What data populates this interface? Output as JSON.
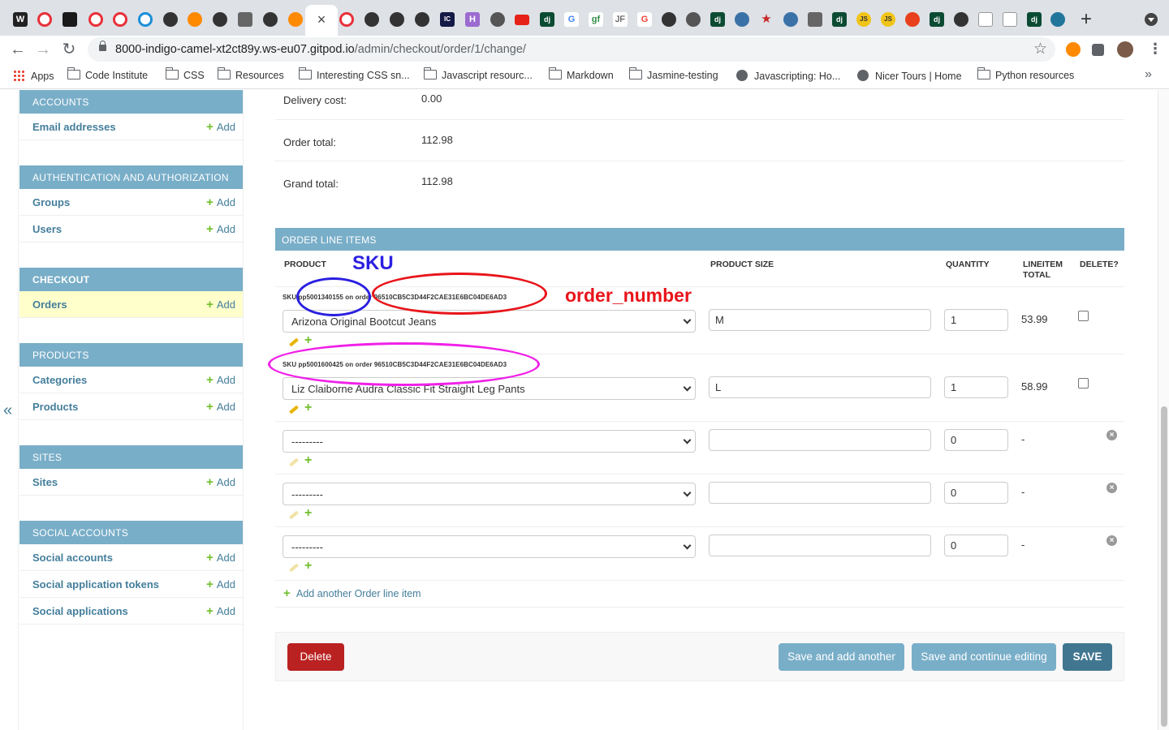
{
  "browser": {
    "url_host": "8000-indigo-camel-xt2ct89y.ws-eu07.gitpod.io",
    "url_path": "/admin/checkout/order/1/change/",
    "tab_icons": [
      "W",
      "O",
      "",
      "O",
      "O",
      "O",
      "",
      "G",
      "",
      "",
      "",
      "G",
      "×",
      "O",
      "",
      "",
      "",
      "IC",
      "H",
      "",
      "",
      "dj",
      "G",
      "gf",
      "JF",
      "G",
      "",
      "",
      "dj",
      "",
      "★",
      "",
      "",
      "dj",
      "JS",
      "JS",
      "",
      "dj",
      "",
      "",
      "",
      "dj",
      "",
      "+"
    ],
    "bookmarks": [
      {
        "label": "Apps",
        "icon": "apps-icon"
      },
      {
        "label": "Code Institute",
        "icon": "folder-icon"
      },
      {
        "label": "CSS",
        "icon": "folder-icon"
      },
      {
        "label": "Resources",
        "icon": "folder-icon"
      },
      {
        "label": "Interesting CSS sn...",
        "icon": "folder-icon"
      },
      {
        "label": "Javascript resourc...",
        "icon": "folder-icon"
      },
      {
        "label": "Markdown",
        "icon": "folder-icon"
      },
      {
        "label": "Jasmine-testing",
        "icon": "folder-icon"
      },
      {
        "label": "Javascripting: Ho...",
        "icon": "globe-icon"
      },
      {
        "label": "Nicer Tours | Home",
        "icon": "globe-icon"
      },
      {
        "label": "Python resources",
        "icon": "folder-icon"
      }
    ],
    "more": "»"
  },
  "sidebar": {
    "add_label": "Add",
    "modules": [
      {
        "title": "ACCOUNTS",
        "items": [
          {
            "name": "Email addresses"
          }
        ]
      },
      {
        "title": "AUTHENTICATION AND AUTHORIZATION",
        "items": [
          {
            "name": "Groups"
          },
          {
            "name": "Users"
          }
        ]
      },
      {
        "title": "CHECKOUT",
        "items": [
          {
            "name": "Orders"
          }
        ]
      },
      {
        "title": "PRODUCTS",
        "items": [
          {
            "name": "Categories"
          },
          {
            "name": "Products"
          }
        ]
      },
      {
        "title": "SITES",
        "items": [
          {
            "name": "Sites"
          }
        ]
      },
      {
        "title": "SOCIAL ACCOUNTS",
        "items": [
          {
            "name": "Social accounts"
          },
          {
            "name": "Social application tokens"
          },
          {
            "name": "Social applications"
          }
        ]
      }
    ],
    "collapse": "«"
  },
  "order": {
    "fields": [
      {
        "label": "Delivery cost:",
        "value": "0.00"
      },
      {
        "label": "Order total:",
        "value": "112.98"
      },
      {
        "label": "Grand total:",
        "value": "112.98"
      }
    ]
  },
  "inline": {
    "title": "ORDER LINE ITEMS",
    "columns": {
      "product": "PRODUCT",
      "size": "PRODUCT SIZE",
      "quantity": "QUANTITY",
      "total_line1": "LINEITEM",
      "total_line2": "TOTAL",
      "delete": "DELETE?"
    },
    "rows": [
      {
        "original": "SKU pp5001340155 on order 96510CB5C3D44F2CAE31E6BC04DE6AD3",
        "product": "Arizona Original Bootcut Jeans",
        "size": "M",
        "quantity": "1",
        "total": "53.99"
      },
      {
        "original": "SKU pp5001600425 on order 96510CB5C3D44F2CAE31E6BC04DE6AD3",
        "product": "Liz Claiborne Audra Classic Fit Straight Leg Pants",
        "size": "L",
        "quantity": "1",
        "total": "58.99"
      },
      {
        "original": "",
        "product": "---------",
        "size": "",
        "quantity": "0",
        "total": "-"
      },
      {
        "original": "",
        "product": "---------",
        "size": "",
        "quantity": "0",
        "total": "-"
      },
      {
        "original": "",
        "product": "---------",
        "size": "",
        "quantity": "0",
        "total": "-"
      }
    ],
    "add_another": "Add another Order line item"
  },
  "submit": {
    "delete": "Delete",
    "save_add": "Save and add another",
    "save_continue": "Save and continue editing",
    "save": "SAVE"
  },
  "annotations": {
    "sku_label": "SKU",
    "order_number_label": "order_number",
    "colors": {
      "blue": "#2a1fe0",
      "red": "#e8141a",
      "magenta": "#f020e8"
    }
  }
}
